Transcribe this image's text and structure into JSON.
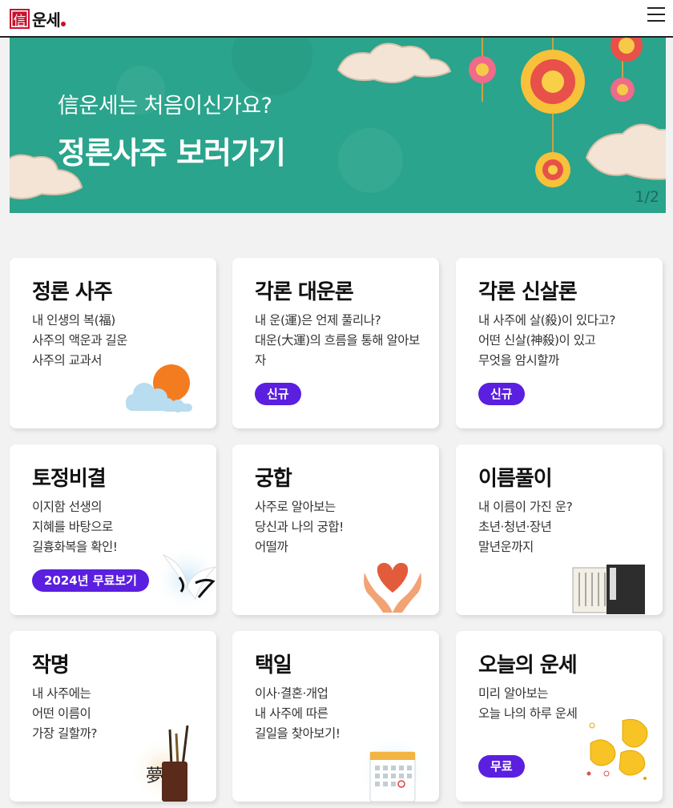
{
  "header": {
    "logo_seal": "信",
    "logo_text": "운세",
    "menu_icon": "hamburger-menu-icon"
  },
  "banner": {
    "subtitle": "信운세는 처음이신가요?",
    "title": "정론사주 보러가기",
    "page_indicator": "1/2",
    "background_color": "#2aa48c"
  },
  "cards": [
    {
      "title": "정론 사주",
      "lines": [
        "내 인생의 복(福)",
        "사주의 액운과 길운",
        "사주의 교과서"
      ],
      "badge": "",
      "icon": "sun-cloud-icon"
    },
    {
      "title": "각론 대운론",
      "lines": [
        "내 운(運)은 언제 풀리나?",
        "대운(大運)의 흐름을 통해 알아보",
        "자"
      ],
      "badge": "신규",
      "icon": ""
    },
    {
      "title": "각론 신살론",
      "lines": [
        "내 사주에 살(殺)이 있다고?",
        "어떤 신살(神殺)이 있고",
        "무엇을 암시할까"
      ],
      "badge": "신규",
      "icon": ""
    },
    {
      "title": "토정비결",
      "lines": [
        "이지함 선생의",
        "지혜를 바탕으로",
        "길흉화복을 확인!"
      ],
      "badge": "2024년 무료보기",
      "icon": "crane-icon"
    },
    {
      "title": "궁합",
      "lines": [
        "사주로 알아보는",
        "당신과 나의 궁합!",
        "어떨까"
      ],
      "badge": "",
      "icon": "heart-hands-icon"
    },
    {
      "title": "이름풀이",
      "lines": [
        "내 이름이 가진 운?",
        "초년·청년·장년",
        "말년운까지"
      ],
      "badge": "",
      "icon": "book-icon"
    },
    {
      "title": "작명",
      "lines": [
        "내 사주에는",
        "어떤 이름이",
        "가장 길할까?"
      ],
      "badge": "",
      "icon": "brush-holder-icon"
    },
    {
      "title": "택일",
      "lines": [
        "이사·결혼·개업",
        "내 사주에 따른",
        "길일을 찾아보기!"
      ],
      "badge": "",
      "icon": "calendar-icon"
    },
    {
      "title": "오늘의 운세",
      "lines": [
        "미리 알아보는",
        "오늘 나의 하루 운세"
      ],
      "badge": "무료",
      "icon": "fortune-cookie-icon"
    }
  ],
  "colors": {
    "badge": "#5b1fe0",
    "accent_red": "#c8102e"
  }
}
